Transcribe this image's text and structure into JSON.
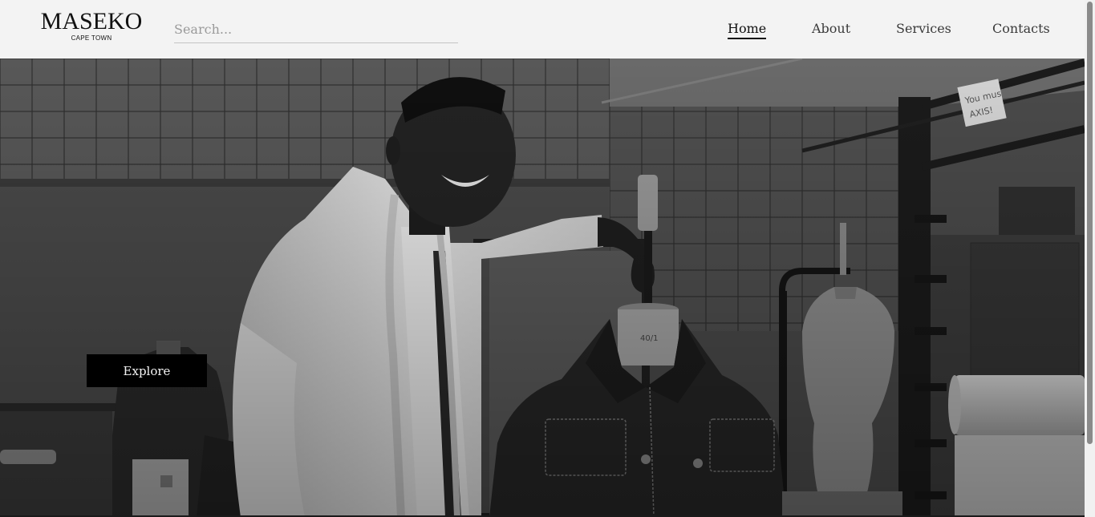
{
  "logo": {
    "name": "MASEKO",
    "tagline": "CAPE TOWN"
  },
  "search": {
    "placeholder": "Search...",
    "value": ""
  },
  "nav": {
    "items": [
      {
        "label": "Home",
        "active": true
      },
      {
        "label": "About",
        "active": false
      },
      {
        "label": "Services",
        "active": false
      },
      {
        "label": "Contacts",
        "active": false
      }
    ]
  },
  "hero": {
    "button_label": "Explore",
    "sign_text": "You must AXIS!!",
    "mannequin_tag": "40/1"
  },
  "colors": {
    "header_bg": "#f3f3f3",
    "button_bg": "#000000",
    "button_text": "#f3f3f3",
    "text": "#111111"
  }
}
